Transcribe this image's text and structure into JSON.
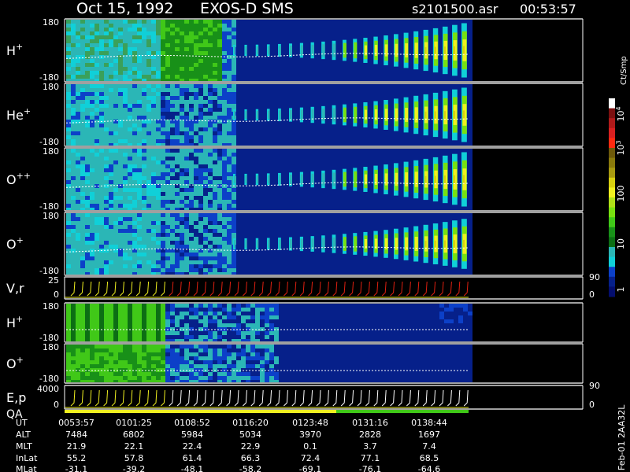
{
  "header": {
    "date": "Oct 15, 1992",
    "instrument": "EXOS-D SMS",
    "file": "s2101500.asr",
    "time": "00:53:57"
  },
  "panels": [
    {
      "label": "H",
      "sup": "+",
      "ytop": "180",
      "ybot": "-180"
    },
    {
      "label": "He",
      "sup": "+",
      "ytop": "180",
      "ybot": "-180"
    },
    {
      "label": "O",
      "sup": "++",
      "ytop": "180",
      "ybot": "-180"
    },
    {
      "label": "O",
      "sup": "+",
      "ytop": "180",
      "ybot": "-180"
    },
    {
      "label": "V,r",
      "sup": "",
      "ytop": "25",
      "ybot": "0",
      "rtop": "90",
      "rbot": "0"
    },
    {
      "label": "H",
      "sup": "+",
      "ytop": "180",
      "ybot": "-180"
    },
    {
      "label": "O",
      "sup": "+",
      "ytop": "180",
      "ybot": "-180"
    },
    {
      "label": "E,p",
      "sup": "",
      "label2": "QA",
      "ytop": "4000",
      "ybot": "0",
      "rtop": "90",
      "rbot": "0"
    }
  ],
  "colorbar": {
    "title": "Ct/Smp",
    "labels": [
      {
        "text": "10",
        "sup": "4"
      },
      {
        "text": "10",
        "sup": "3"
      },
      {
        "text": "100",
        "sup": ""
      },
      {
        "text": "10",
        "sup": ""
      },
      {
        "text": "1",
        "sup": ""
      }
    ],
    "colors": [
      "#ffffff",
      "#7b1010",
      "#b01a1a",
      "#d82020",
      "#ff2a10",
      "#6e5a0a",
      "#8a7a0c",
      "#a89a10",
      "#d8d010",
      "#f0f020",
      "#b0e018",
      "#78e010",
      "#40c818",
      "#189018",
      "#0c6e14",
      "#2bb6b6",
      "#10d0d8",
      "#0c40c8",
      "#06208a",
      "#040e6e"
    ]
  },
  "footer": {
    "row_labels": [
      "UT",
      "ALT",
      "MLT",
      "InLat",
      "MLat"
    ],
    "columns": [
      {
        "UT": "0053:57",
        "ALT": "7484",
        "MLT": "21.9",
        "InLat": "55.2",
        "MLat": "-31.1"
      },
      {
        "UT": "0101:25",
        "ALT": "6802",
        "MLT": "22.1",
        "InLat": "57.8",
        "MLat": "-39.2"
      },
      {
        "UT": "0108:52",
        "ALT": "5984",
        "MLT": "22.4",
        "InLat": "61.4",
        "MLat": "-48.1"
      },
      {
        "UT": "0116:20",
        "ALT": "5034",
        "MLT": "22.9",
        "InLat": "66.3",
        "MLat": "-58.2"
      },
      {
        "UT": "0123:48",
        "ALT": "3970",
        "MLT": "0.1",
        "InLat": "72.4",
        "MLat": "-69.1"
      },
      {
        "UT": "0131:16",
        "ALT": "2828",
        "MLT": "3.7",
        "InLat": "77.1",
        "MLat": "-76.1"
      },
      {
        "UT": "0138:44",
        "ALT": "1697",
        "MLT": "7.4",
        "InLat": "68.5",
        "MLat": "-64.6"
      }
    ],
    "side_note": "Feb-01  2AA32L"
  },
  "chart_data": {
    "type": "heatmap",
    "title": "Oct 15, 1992   EXOS-D SMS",
    "x_axis": {
      "quantity": "UT",
      "ticks": [
        "0053:57",
        "0101:25",
        "0108:52",
        "0116:20",
        "0123:48",
        "0131:16",
        "0138:44"
      ]
    },
    "colorscale": {
      "label": "Ct/Smp",
      "min": 1,
      "max": 10000,
      "log": true
    },
    "series": [
      {
        "name": "H+",
        "yrange": [
          -180,
          180
        ]
      },
      {
        "name": "He+",
        "yrange": [
          -180,
          180
        ]
      },
      {
        "name": "O++",
        "yrange": [
          -180,
          180
        ]
      },
      {
        "name": "O+",
        "yrange": [
          -180,
          180
        ]
      },
      {
        "name": "V,r",
        "yrange": [
          0,
          25
        ],
        "yrange_right": [
          0,
          90
        ]
      },
      {
        "name": "H+",
        "yrange": [
          -180,
          180
        ]
      },
      {
        "name": "O+",
        "yrange": [
          -180,
          180
        ]
      },
      {
        "name": "E,p",
        "yrange": [
          0,
          4000
        ],
        "yrange_right": [
          0,
          90
        ]
      }
    ]
  }
}
